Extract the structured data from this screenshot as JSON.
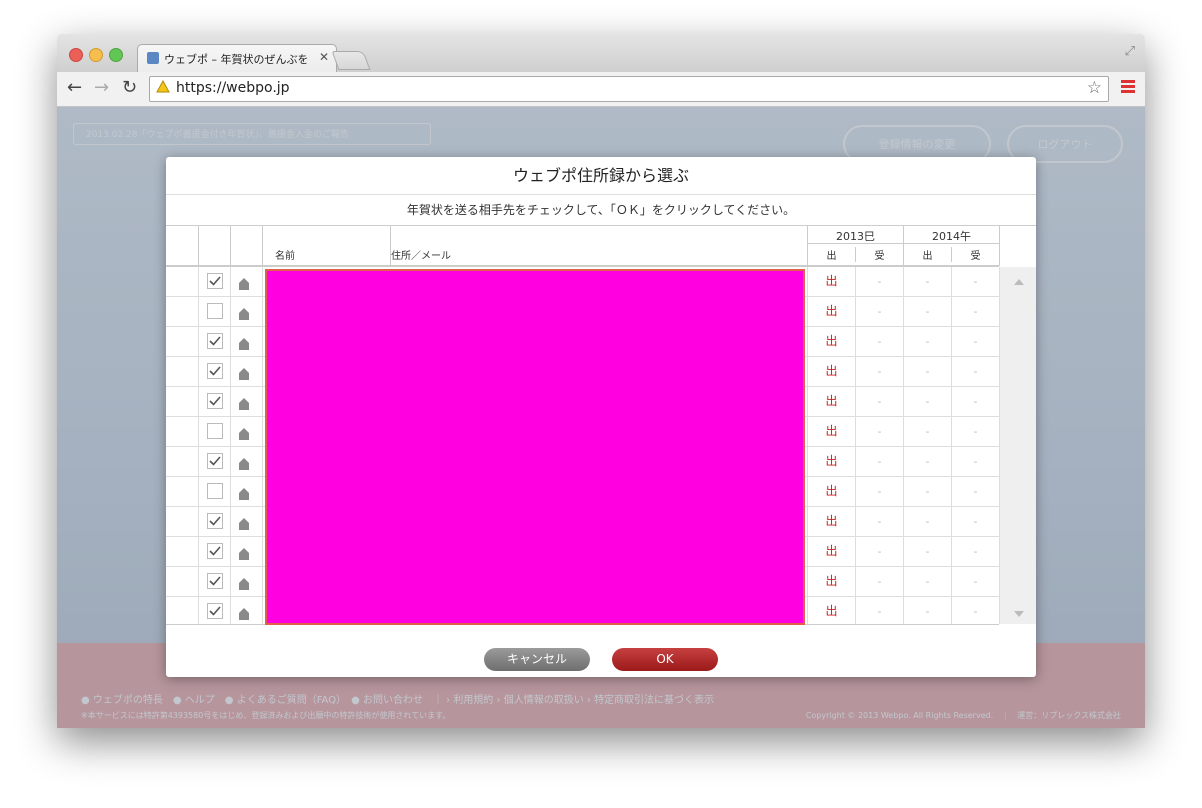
{
  "browser": {
    "tab_title": "ウェブポ – 年賀状のぜんぶを",
    "url": "https://webpo.jp"
  },
  "page": {
    "notice": "2013.02.28「ウェブポ義援金付き年賀状」、義援金入金のご報告",
    "buttons": {
      "edit_profile": "登録情報の変更",
      "logout": "ログアウト"
    },
    "footer": {
      "links": "● ウェブポの特長　● ヘルプ　● よくあるご質問（FAQ）　● お問い合わせ　｜ › 利用規約 › 個人情報の取扱い › 特定商取引法に基づく表示",
      "note": "※本サービスには特許第4393580号をはじめ、登録済みおよび出願中の特許技術が使用されています。",
      "copyright": "Copyright © 2013 Webpo. All Rights Reserved.　｜　運営：リプレックス株式会社"
    }
  },
  "modal": {
    "title": "ウェブポ住所録から選ぶ",
    "instruction": "年賀状を送る相手先をチェックして、「ＯＫ」をクリックしてください。",
    "headers": {
      "name": "名前",
      "address": "住所／メール",
      "year_2013": "2013巳",
      "year_2014": "2014午",
      "sent": "出",
      "received": "受"
    },
    "rows": [
      {
        "checked": true,
        "sent_2013": "出",
        "recv_2013": "-",
        "sent_2014": "-",
        "recv_2014": "-"
      },
      {
        "checked": false,
        "sent_2013": "出",
        "recv_2013": "-",
        "sent_2014": "-",
        "recv_2014": "-"
      },
      {
        "checked": true,
        "sent_2013": "出",
        "recv_2013": "-",
        "sent_2014": "-",
        "recv_2014": "-"
      },
      {
        "checked": true,
        "sent_2013": "出",
        "recv_2013": "-",
        "sent_2014": "-",
        "recv_2014": "-"
      },
      {
        "checked": true,
        "sent_2013": "出",
        "recv_2013": "-",
        "sent_2014": "-",
        "recv_2014": "-"
      },
      {
        "checked": false,
        "sent_2013": "出",
        "recv_2013": "-",
        "sent_2014": "-",
        "recv_2014": "-"
      },
      {
        "checked": true,
        "sent_2013": "出",
        "recv_2013": "-",
        "sent_2014": "-",
        "recv_2014": "-"
      },
      {
        "checked": false,
        "sent_2013": "出",
        "recv_2013": "-",
        "sent_2014": "-",
        "recv_2014": "-"
      },
      {
        "checked": true,
        "sent_2013": "出",
        "recv_2013": "-",
        "sent_2014": "-",
        "recv_2014": "-"
      },
      {
        "checked": true,
        "sent_2013": "出",
        "recv_2013": "-",
        "sent_2014": "-",
        "recv_2014": "-"
      },
      {
        "checked": true,
        "sent_2013": "出",
        "recv_2013": "-",
        "sent_2014": "-",
        "recv_2014": "-"
      },
      {
        "checked": true,
        "sent_2013": "出",
        "recv_2013": "-",
        "sent_2014": "-",
        "recv_2014": "-"
      }
    ],
    "cancel_label": "キャンセル",
    "ok_label": "OK"
  },
  "colors": {
    "redaction": "#ff00e0",
    "ok_button": "#b02828",
    "sent_mark": "#cc2222"
  }
}
